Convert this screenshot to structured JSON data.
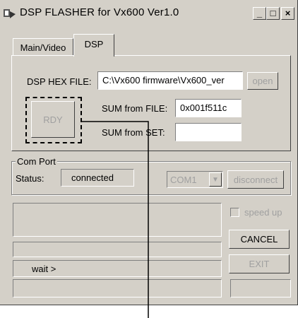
{
  "window": {
    "title": "DSP FLASHER for Vx600  Ver1.0",
    "minimize": "_",
    "maximize": "□",
    "close": "×"
  },
  "tabs": [
    {
      "label": "Main/Video"
    },
    {
      "label": "DSP"
    }
  ],
  "dsp": {
    "hex_file_label": "DSP HEX FILE:",
    "hex_file_value": "C:\\Vx600 firmware\\Vx600_ver",
    "open_label": "open",
    "rdy_label": "RDY",
    "sum_file_label": "SUM from FILE:",
    "sum_file_value": "0x001f511c",
    "sum_set_label": "SUM from SET:",
    "sum_set_value": ""
  },
  "comport": {
    "group_label": "Com Port",
    "status_label": "Status:",
    "status_value": "connected",
    "port_value": "COM1",
    "disconnect_label": "disconnect"
  },
  "log": {
    "line1": "",
    "line2": "",
    "line3": "wait >",
    "line4": ""
  },
  "controls": {
    "speed_up_label": "speed up",
    "cancel_label": "CANCEL",
    "exit_label": "EXIT",
    "progress_value": ""
  },
  "colors": {
    "face": "#d4d0c8",
    "shadow": "#808080",
    "highlight": "#ffffff"
  }
}
